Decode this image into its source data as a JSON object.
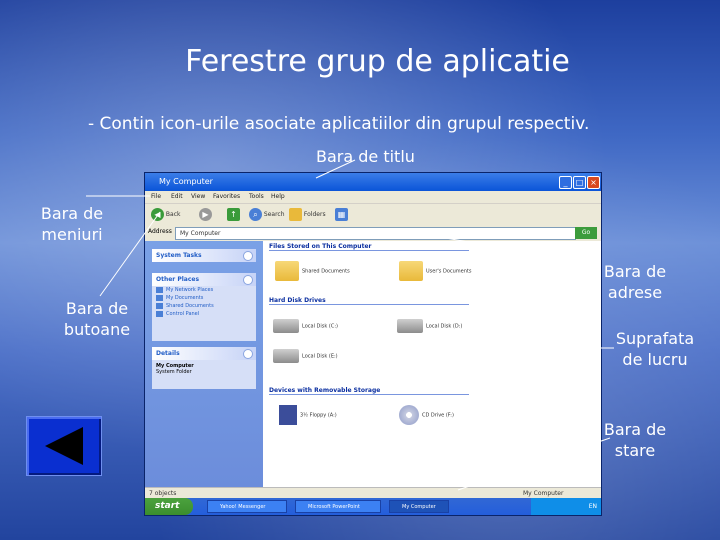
{
  "slide": {
    "title": "Ferestre grup de aplicatie",
    "subtitle": "- Contin icon-urile asociate aplicatiilor din grupul respectiv.",
    "labels": {
      "titlebar": "Bara de titlu",
      "menubar_1": "Bara de",
      "menubar_2": "meniuri",
      "buttons_1": "Bara de",
      "buttons_2": "butoane",
      "address_1": "Bara de",
      "address_2": "adrese",
      "workspace_1": "Suprafata",
      "workspace_2": "de lucru",
      "status_1": "Bara de",
      "status_2": "stare"
    }
  },
  "window": {
    "title": "My Computer",
    "controls": {
      "minimize": "_",
      "maximize": "□",
      "close": "×"
    },
    "menu": [
      "File",
      "Edit",
      "View",
      "Favorites",
      "Tools",
      "Help"
    ],
    "toolbar": {
      "back": "Back",
      "search": "Search",
      "folders": "Folders"
    },
    "address": {
      "label": "Address",
      "value": "My Computer",
      "go": "Go"
    },
    "left_pane": {
      "system_tasks": "System Tasks",
      "other_places": "Other Places",
      "other_places_items": [
        "My Network Places",
        "My Documents",
        "Shared Documents",
        "Control Panel"
      ],
      "details": "Details",
      "details_name": "My Computer",
      "details_desc": "System Folder"
    },
    "content": {
      "group_files": "Files Stored on This Computer",
      "shared_docs": "Shared Documents",
      "user_docs": "User's Documents",
      "group_hdd": "Hard Disk Drives",
      "drive_c": "Local Disk (C:)",
      "drive_d": "Local Disk (D:)",
      "drive_e": "Local Disk (E:)",
      "group_removable": "Devices with Removable Storage",
      "floppy": "3½ Floppy (A:)",
      "cd": "CD Drive (F:)"
    },
    "status": {
      "left": "7 objects",
      "right": "My Computer"
    },
    "taskbar": {
      "start": "start",
      "tasks": [
        "Yahoo! Messenger",
        "Microsoft PowerPoint",
        "My Computer"
      ],
      "clock": "EN"
    }
  },
  "nav_button": {
    "icon": "back-triangle-icon"
  }
}
